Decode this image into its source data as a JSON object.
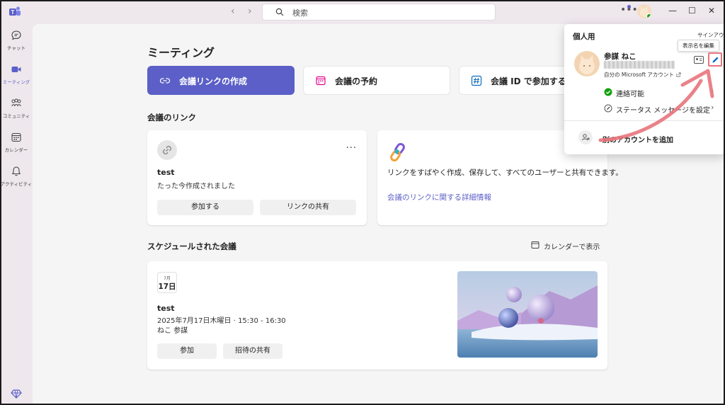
{
  "titlebar": {
    "search_placeholder": "検索",
    "more_label": "•••",
    "minimize": "—",
    "maximize": "☐",
    "close": "✕"
  },
  "rail": [
    {
      "label": "チャット",
      "icon": "chat-icon"
    },
    {
      "label": "ミーティング",
      "icon": "video-icon",
      "active": true
    },
    {
      "label": "コミュニティ",
      "icon": "community-icon"
    },
    {
      "label": "カレンダー",
      "icon": "calendar-icon"
    },
    {
      "label": "アクティビティ",
      "icon": "bell-icon"
    }
  ],
  "page_title": "ミーティング",
  "actions": {
    "create_link": "会議リンクの作成",
    "schedule": "会議の予約",
    "join_by_id": "会議 ID で参加する"
  },
  "links_section": {
    "title": "会議のリンク",
    "card": {
      "name": "test",
      "subtitle": "たった今作成されました",
      "more": "···",
      "join_label": "参加する",
      "share_label": "リンクの共有"
    },
    "info": {
      "text": "リンクをすばやく作成、保存して、すべてのユーザーと共有できます。",
      "link": "会議のリンクに関する詳細情報"
    }
  },
  "scheduled_section": {
    "title": "スケジュールされた会議",
    "calendar_view": "カレンダーで表示",
    "meeting": {
      "month": "7月",
      "day": "17日",
      "name": "test",
      "datetime": "2025年7月17日木曜日  ·  15:30 - 16:30",
      "organizer": "ねこ 参謀",
      "join_label": "参加",
      "share_label": "招待の共有"
    }
  },
  "profile_popup": {
    "title": "個人用",
    "sign_out": "サインアウト",
    "tooltip": "表示名を編集",
    "name": "参謀 ねこ",
    "account_label": "自分の Microsoft アカウント",
    "status": "連絡可能",
    "status_message": "ステータス メッセージを設定",
    "add_account": "別のアカウントを追加",
    "chevron": "›"
  },
  "colors": {
    "accent": "#5b5fc7",
    "available": "#13a10e",
    "annotation": "#e8747c"
  }
}
